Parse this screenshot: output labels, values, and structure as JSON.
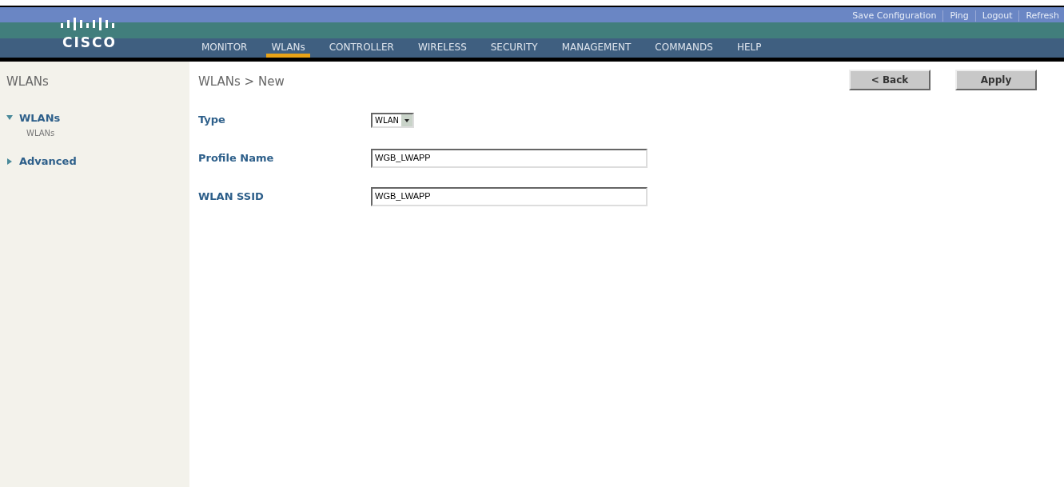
{
  "header": {
    "brand": "CISCO",
    "top_links": [
      "Save Configuration",
      "Ping",
      "Logout",
      "Refresh"
    ],
    "nav": [
      {
        "label": "MONITOR",
        "selected": false
      },
      {
        "label": "WLANs",
        "selected": true
      },
      {
        "label": "CONTROLLER",
        "selected": false
      },
      {
        "label": "WIRELESS",
        "selected": false
      },
      {
        "label": "SECURITY",
        "selected": false
      },
      {
        "label": "MANAGEMENT",
        "selected": false
      },
      {
        "label": "COMMANDS",
        "selected": false
      },
      {
        "label": "HELP",
        "selected": false
      }
    ]
  },
  "sidebar": {
    "title": "WLANs",
    "items": [
      {
        "label": "WLANs",
        "expanded": true,
        "children": [
          {
            "label": "WLANs"
          }
        ]
      },
      {
        "label": "Advanced",
        "expanded": false
      }
    ]
  },
  "content": {
    "breadcrumb": "WLANs > New",
    "buttons": [
      "< Back",
      "Apply"
    ],
    "fields": [
      {
        "kind": "select",
        "label": "Type",
        "value": "WLAN"
      },
      {
        "kind": "text",
        "label": "Profile Name",
        "value": "WGB_LWAPP"
      },
      {
        "kind": "text",
        "label": "WLAN SSID",
        "value": "WGB_LWAPP"
      }
    ]
  }
}
